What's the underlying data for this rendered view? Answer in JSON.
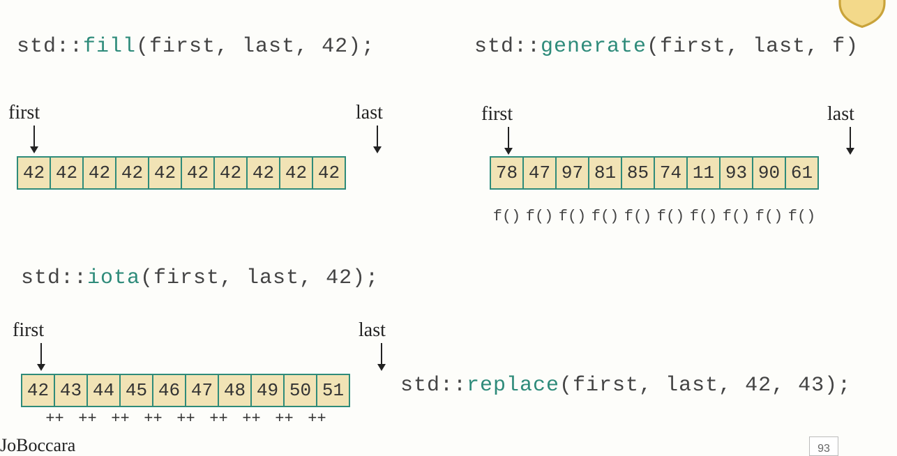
{
  "fill": {
    "prefix": "std::",
    "fn": "fill",
    "args": "(first, last, 42);",
    "first_label": "first",
    "last_label": "last",
    "cells": [
      "42",
      "42",
      "42",
      "42",
      "42",
      "42",
      "42",
      "42",
      "42",
      "42"
    ]
  },
  "generate": {
    "prefix": "std::",
    "fn": "generate",
    "args": "(first, last, f)",
    "first_label": "first",
    "last_label": "last",
    "cells": [
      "78",
      "47",
      "97",
      "81",
      "85",
      "74",
      "11",
      "93",
      "90",
      "61"
    ],
    "below": [
      "f()",
      "f()",
      "f()",
      "f()",
      "f()",
      "f()",
      "f()",
      "f()",
      "f()",
      "f()"
    ]
  },
  "iota": {
    "prefix": "std::",
    "fn": "iota",
    "args": "(first, last, 42);",
    "first_label": "first",
    "last_label": "last",
    "cells": [
      "42",
      "43",
      "44",
      "45",
      "46",
      "47",
      "48",
      "49",
      "50",
      "51"
    ],
    "below": [
      "++",
      "++",
      "++",
      "++",
      "++",
      "++",
      "++",
      "++",
      "++",
      ""
    ]
  },
  "replace": {
    "prefix": "std::",
    "fn": "replace",
    "args": "(first, last, 42, 43);"
  },
  "footer": {
    "handle": "JoBoccara",
    "page": "93"
  }
}
